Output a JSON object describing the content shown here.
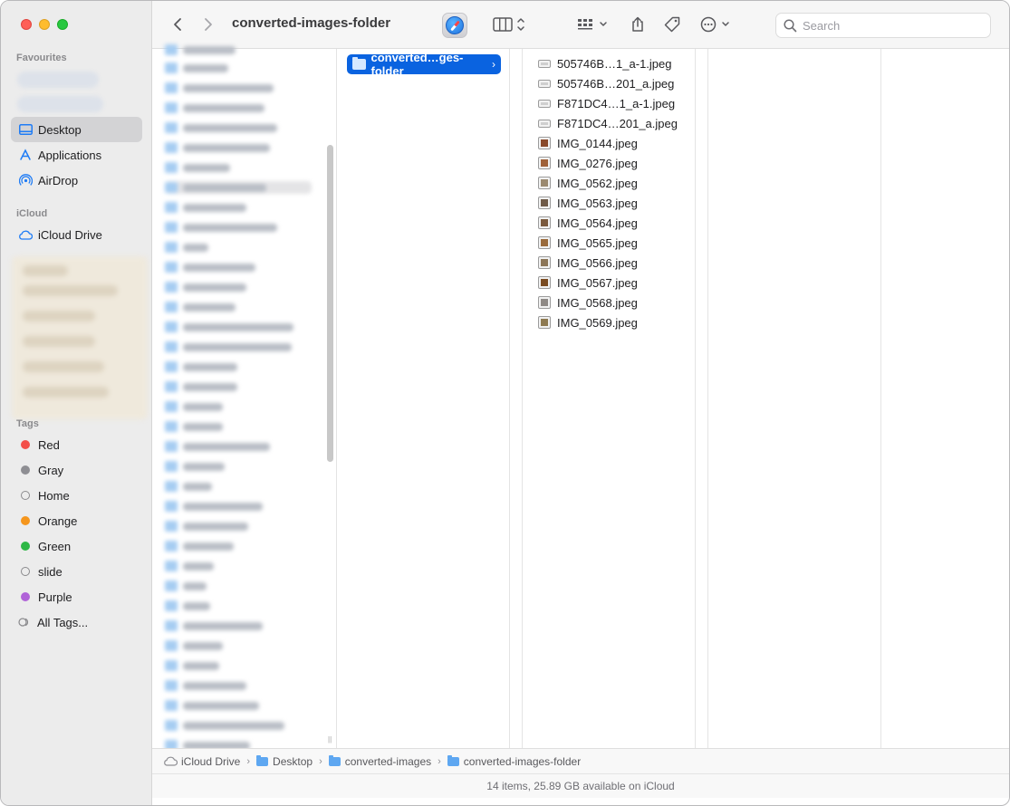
{
  "window": {
    "title": "converted-images-folder"
  },
  "toolbar": {
    "back_icon": "chevron-left-icon",
    "forward_icon": "chevron-right-icon",
    "search_placeholder": "Search"
  },
  "sidebar": {
    "favourites_label": "Favourites",
    "favourites": [
      {
        "label": "Desktop",
        "icon": "desktop-icon",
        "selected": true
      },
      {
        "label": "Applications",
        "icon": "applications-icon"
      },
      {
        "label": "AirDrop",
        "icon": "airdrop-icon"
      }
    ],
    "icloud_label": "iCloud",
    "icloud_items": [
      {
        "label": "iCloud Drive",
        "icon": "cloud-icon"
      }
    ],
    "tags_label": "Tags",
    "tags": [
      {
        "label": "Red",
        "color": "#f34f49"
      },
      {
        "label": "Gray",
        "color": "#8e8e93"
      },
      {
        "label": "Home",
        "color": ""
      },
      {
        "label": "Orange",
        "color": "#f5961d"
      },
      {
        "label": "Green",
        "color": "#2db745"
      },
      {
        "label": "slide",
        "color": ""
      },
      {
        "label": "Purple",
        "color": "#b063d8"
      },
      {
        "label": "All Tags...",
        "color": ""
      }
    ]
  },
  "columns": {
    "folder_column": {
      "selected_folder": "converted…ges-folder"
    },
    "files": [
      "505746B…1_a-1.jpeg",
      "505746B…201_a.jpeg",
      "F871DC4…1_a-1.jpeg",
      "F871DC4…201_a.jpeg",
      "IMG_0144.jpeg",
      "IMG_0276.jpeg",
      "IMG_0562.jpeg",
      "IMG_0563.jpeg",
      "IMG_0564.jpeg",
      "IMG_0565.jpeg",
      "IMG_0566.jpeg",
      "IMG_0567.jpeg",
      "IMG_0568.jpeg",
      "IMG_0569.jpeg"
    ]
  },
  "pathbar": {
    "crumbs": [
      "iCloud Drive",
      "Desktop",
      "converted-images",
      "converted-images-folder"
    ]
  },
  "status": {
    "text": "14 items, 25.89 GB available on iCloud"
  },
  "colors": {
    "accent": "#0a63e0",
    "folder": "#5ea7f1"
  }
}
